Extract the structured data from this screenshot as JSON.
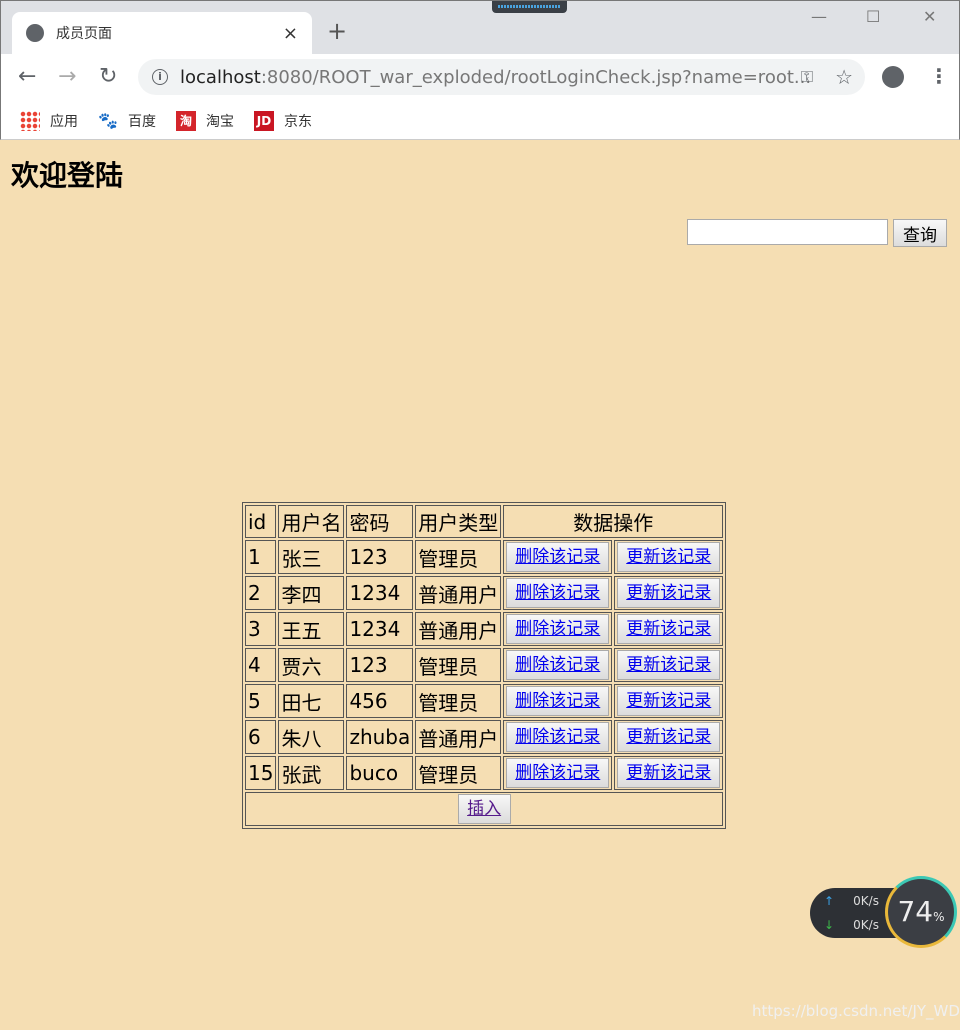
{
  "browser": {
    "tab_title": "成员页面",
    "new_tab": "+",
    "tab_close": "×",
    "url_host": "localhost",
    "url_rest": ":8080/ROOT_war_exploded/rootLoginCheck.jsp?name=root...",
    "win_min": "—",
    "win_max": "☐",
    "win_close": "✕",
    "back": "←",
    "forward": "→",
    "reload": "↻",
    "bookmarks": [
      {
        "label": "应用",
        "icon": "apps-icon"
      },
      {
        "label": "百度",
        "icon": "baidu-icon"
      },
      {
        "label": "淘宝",
        "icon": "taobao-icon",
        "glyph": "淘"
      },
      {
        "label": "京东",
        "icon": "jd-icon",
        "glyph": "JD"
      }
    ]
  },
  "page": {
    "heading": "欢迎登陆",
    "search_value": "",
    "query_button": "查询",
    "table": {
      "headers": [
        "id",
        "用户名",
        "密码",
        "用户类型",
        "数据操作"
      ],
      "rows": [
        [
          "1",
          "张三",
          "123",
          "管理员"
        ],
        [
          "2",
          "李四",
          "1234",
          "普通用户"
        ],
        [
          "3",
          "王五",
          "1234",
          "普通用户"
        ],
        [
          "4",
          "贾六",
          "123",
          "管理员"
        ],
        [
          "5",
          "田七",
          "456",
          "管理员"
        ],
        [
          "6",
          "朱八",
          "zhuba",
          "普通用户"
        ],
        [
          "15",
          "张武",
          "buco",
          "管理员"
        ]
      ],
      "delete_label": "删除该记录",
      "update_label": "更新该记录",
      "insert_label": "插入"
    }
  },
  "overlay": {
    "up": "0K/s",
    "down": "0K/s",
    "percent": "74",
    "percent_sign": "%",
    "watermark": "https://blog.csdn.net/JY_WD"
  }
}
